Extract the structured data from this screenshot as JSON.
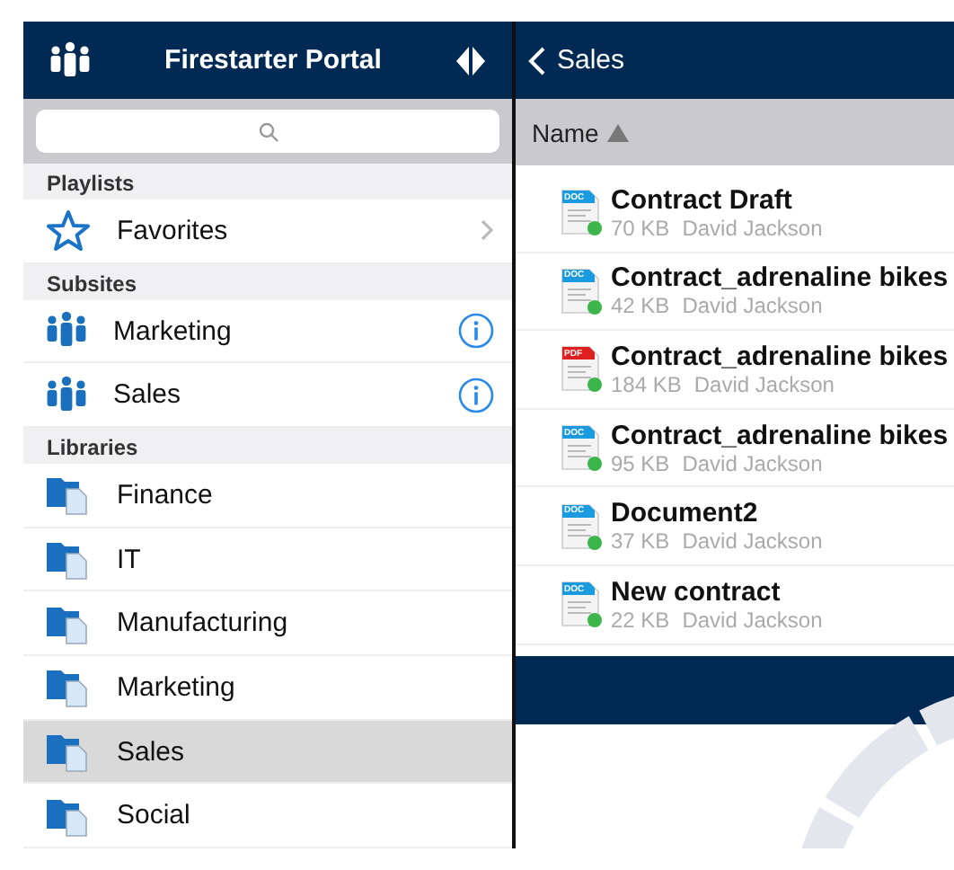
{
  "sidebar": {
    "title": "Firestarter Portal",
    "sections": [
      {
        "heading": "Playlists",
        "items": [
          {
            "kind": "playlist",
            "label": "Favorites",
            "selected": false
          }
        ]
      },
      {
        "heading": "Subsites",
        "items": [
          {
            "kind": "site",
            "label": "Marketing",
            "selected": false
          },
          {
            "kind": "site",
            "label": "Sales",
            "selected": false
          }
        ]
      },
      {
        "heading": "Libraries",
        "items": [
          {
            "kind": "library",
            "label": "Finance",
            "selected": false
          },
          {
            "kind": "library",
            "label": "IT",
            "selected": false
          },
          {
            "kind": "library",
            "label": "Manufacturing",
            "selected": false
          },
          {
            "kind": "library",
            "label": "Marketing",
            "selected": false
          },
          {
            "kind": "library",
            "label": "Sales",
            "selected": true
          },
          {
            "kind": "library",
            "label": "Social",
            "selected": false
          }
        ]
      }
    ]
  },
  "content": {
    "back_label": "Sales",
    "column": {
      "label": "Name",
      "sort_ascending": true
    },
    "files": [
      {
        "kind": "doc",
        "tag": "DOC",
        "name": "Contract Draft",
        "size": "70 KB",
        "author": "David Jackson",
        "color": "#3cb54a"
      },
      {
        "kind": "doc",
        "tag": "DOC",
        "name": "Contract_adrenaline bikes",
        "size": "42 KB",
        "author": "David Jackson",
        "color": "#3cb54a"
      },
      {
        "kind": "pdf",
        "tag": "PDF",
        "name": "Contract_adrenaline bikes",
        "size": "184 KB",
        "author": "David Jackson",
        "color": "#3cb54a"
      },
      {
        "kind": "doc",
        "tag": "DOC",
        "name": "Contract_adrenaline bikes",
        "size": "95 KB",
        "author": "David Jackson",
        "color": "#3cb54a"
      },
      {
        "kind": "doc",
        "tag": "DOC",
        "name": "Document2",
        "size": "37 KB",
        "author": "David Jackson",
        "color": "#3cb54a"
      },
      {
        "kind": "doc",
        "tag": "DOC",
        "name": "New contract",
        "size": "22 KB",
        "author": "David Jackson",
        "color": "#3cb54a"
      }
    ]
  }
}
